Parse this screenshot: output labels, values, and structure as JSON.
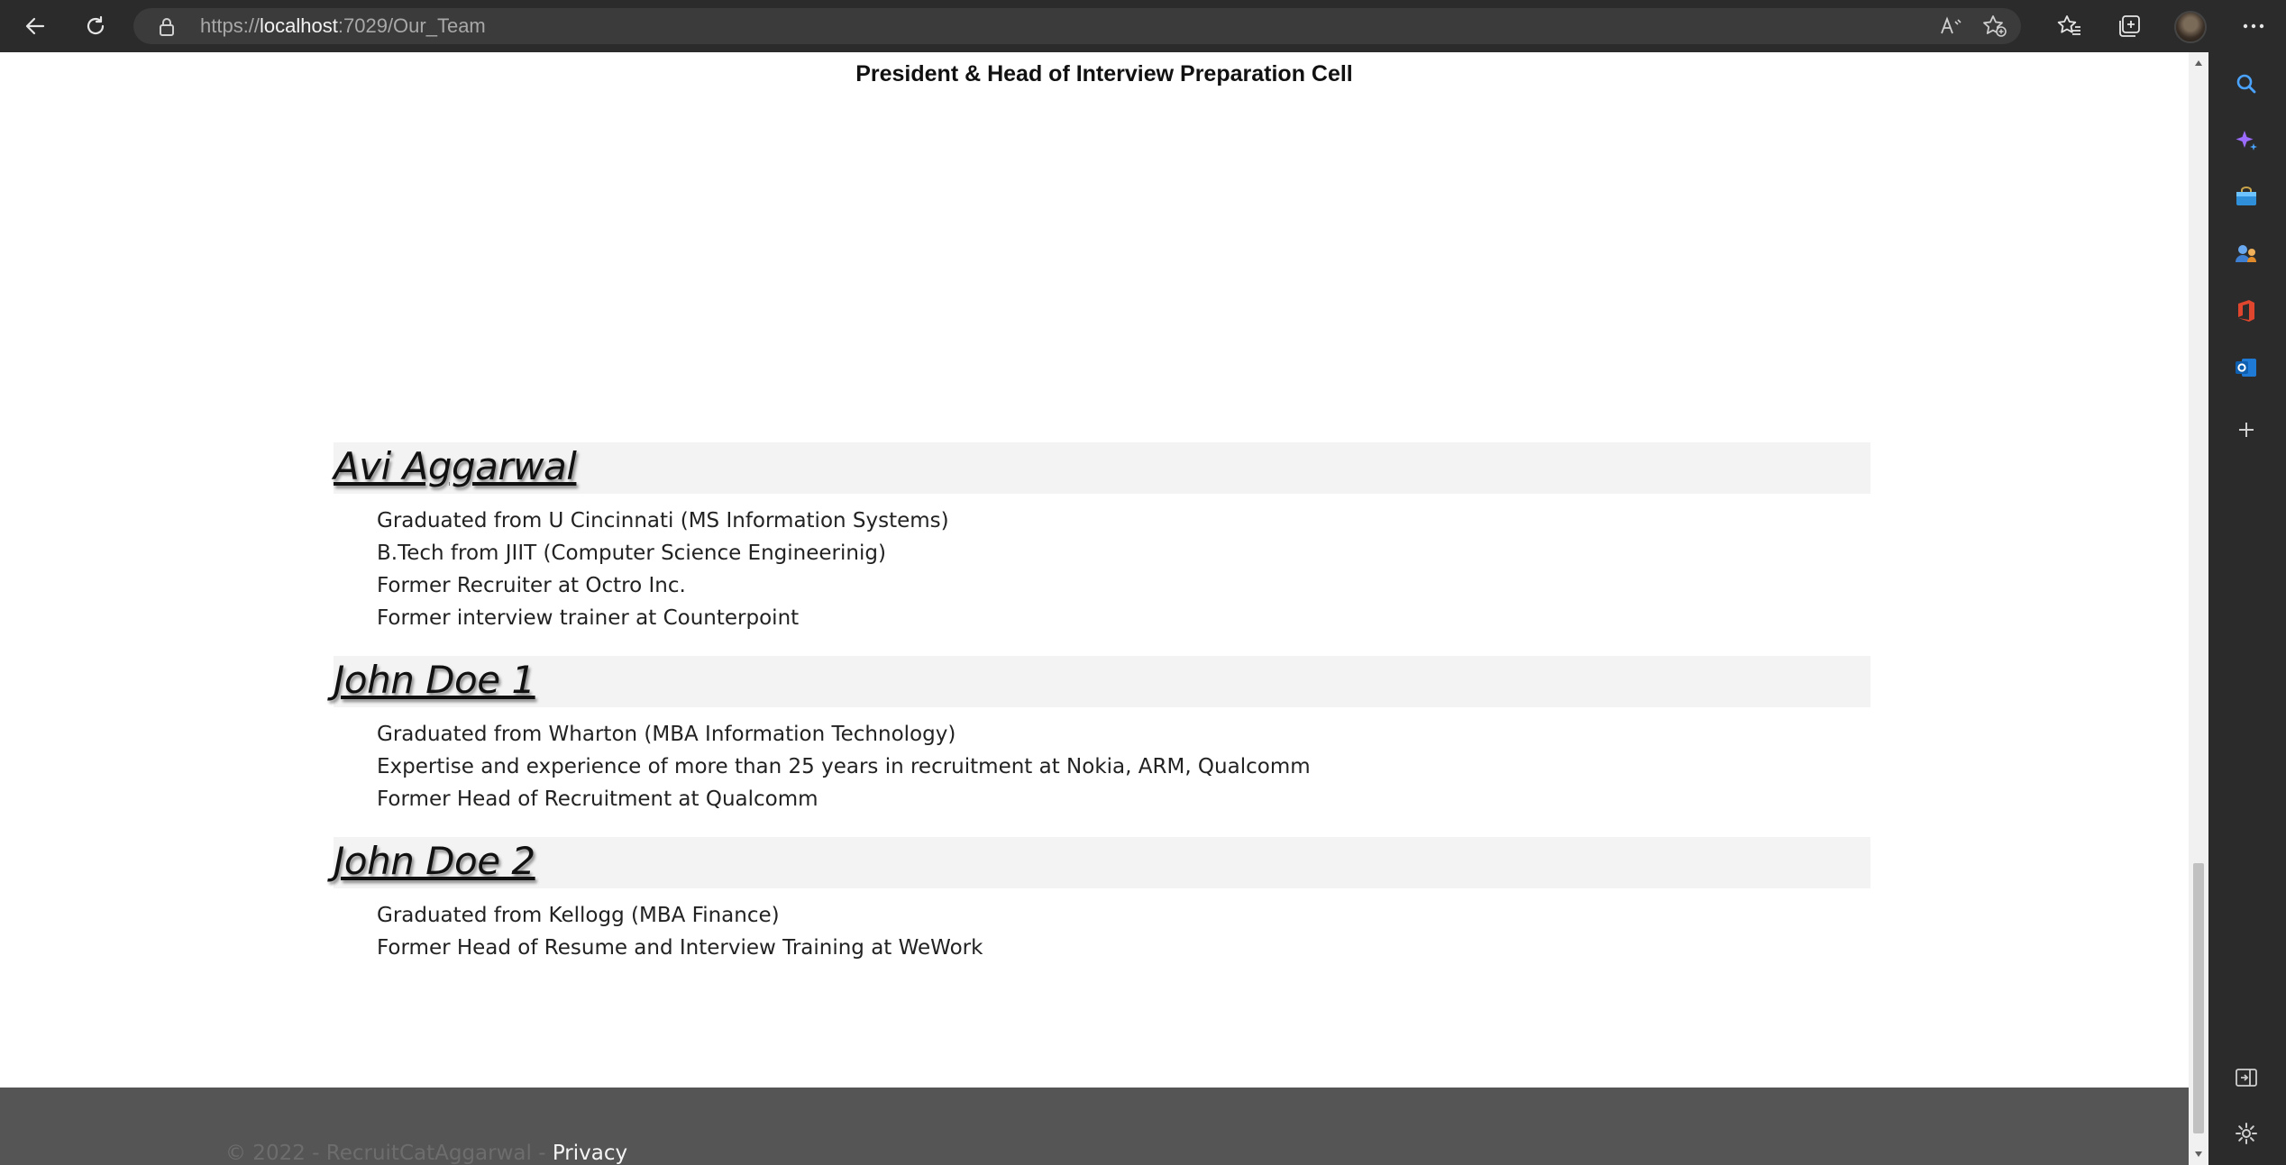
{
  "browser": {
    "url_prefix": "https://",
    "url_host": "localhost",
    "url_path": ":7029/Our_Team"
  },
  "page": {
    "role_title": "President & Head of Interview Preparation Cell",
    "members": [
      {
        "name": "Avi Aggarwal",
        "items": [
          "Graduated from U Cincinnati (MS Information Systems)",
          "B.Tech from JIIT (Computer Science Engineerinig)",
          "Former Recruiter at Octro Inc.",
          "Former interview trainer at Counterpoint"
        ]
      },
      {
        "name": "John Doe 1",
        "items": [
          "Graduated from Wharton (MBA Information Technology)",
          "Expertise and experience of more than 25 years in recruitment at Nokia, ARM, Qualcomm",
          "Former Head of Recruitment at Qualcomm"
        ]
      },
      {
        "name": "John Doe 2",
        "items": [
          "Graduated from Kellogg (MBA Finance)",
          "Former Head of Resume and Interview Training at WeWork"
        ]
      }
    ]
  },
  "footer": {
    "copyright": "© 2022 - RecruitCatAggarwal - ",
    "privacy_link": "Privacy"
  },
  "colors": {
    "browser_chrome": "#2b2b2b",
    "address_bar": "#3b3b3b",
    "member_header_bg": "#f3f3f3",
    "footer_bg": "#555555"
  },
  "icons": {
    "toolbar": [
      "back-icon",
      "refresh-icon",
      "lock-icon",
      "read-aloud-icon",
      "add-favorite-icon",
      "favorites-icon",
      "collections-icon",
      "more-icon"
    ],
    "sidebar": [
      "search-icon",
      "copilot-icon",
      "shopping-icon",
      "people-icon",
      "office-icon",
      "outlook-icon",
      "add-icon",
      "hide-sidebar-icon",
      "settings-icon"
    ]
  }
}
